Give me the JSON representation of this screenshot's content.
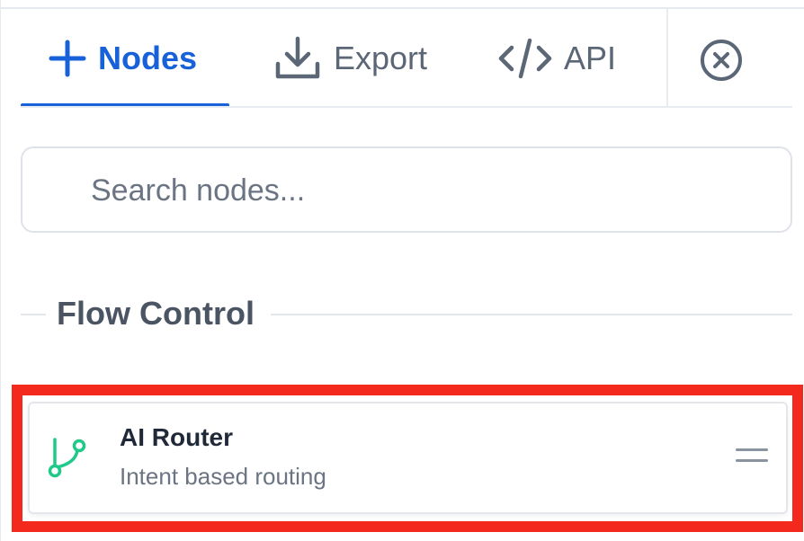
{
  "tabs": {
    "nodes_label": "Nodes",
    "export_label": "Export",
    "api_label": "API"
  },
  "icons": {
    "nodes": "plus-icon",
    "export": "download-icon",
    "api": "code-icon",
    "close": "close-circle-icon",
    "node": "git-branch-icon",
    "drag": "drag-handle-icon"
  },
  "search": {
    "placeholder": "Search nodes...",
    "value": ""
  },
  "section": {
    "title": "Flow Control"
  },
  "node": {
    "title": "AI Router",
    "subtitle": "Intent based routing"
  },
  "colors": {
    "accent": "#1761d9",
    "highlight": "#f2291c",
    "node_icon": "#1fc98a",
    "muted_text": "#5b6676"
  }
}
